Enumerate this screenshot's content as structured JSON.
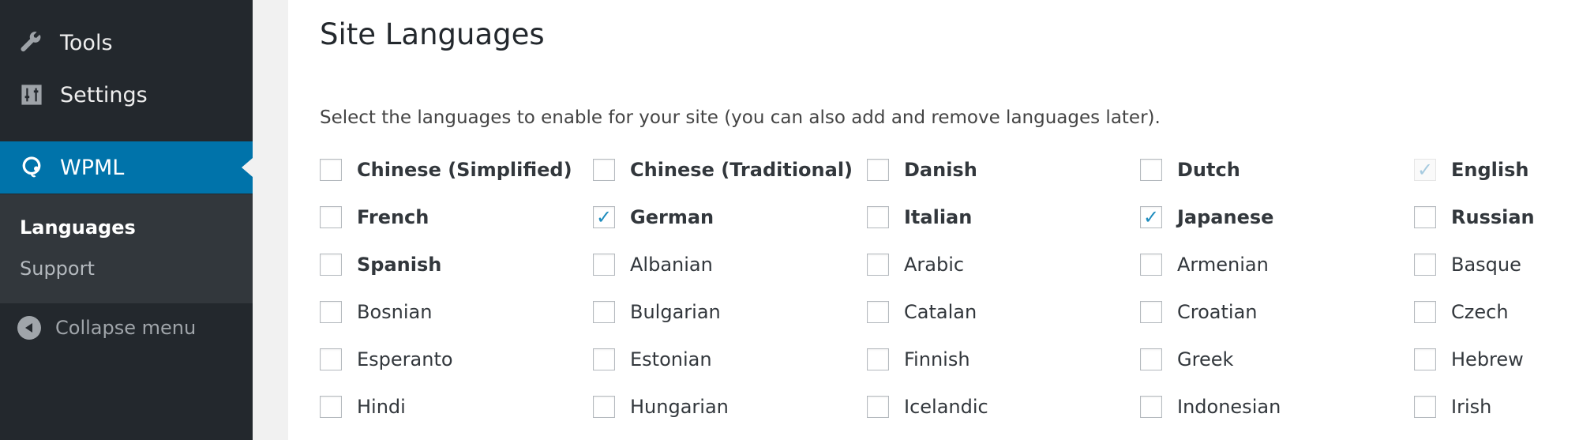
{
  "sidebar": {
    "menu": [
      {
        "label": "Tools",
        "icon": "wrench-icon"
      },
      {
        "label": "Settings",
        "icon": "settings-sliders-icon"
      },
      {
        "label": "WPML",
        "icon": "wpml-icon",
        "current": true
      }
    ],
    "submenu": [
      {
        "label": "Languages",
        "active": true
      },
      {
        "label": "Support",
        "active": false
      }
    ],
    "collapse_label": "Collapse menu"
  },
  "main": {
    "title": "Site Languages",
    "description": "Select the languages to enable for your site (you can also add and remove languages later).",
    "languages": [
      {
        "name": "Chinese (Simplified)",
        "checked": false,
        "bold": true
      },
      {
        "name": "Chinese (Traditional)",
        "checked": false,
        "bold": true
      },
      {
        "name": "Danish",
        "checked": false,
        "bold": true
      },
      {
        "name": "Dutch",
        "checked": false,
        "bold": true
      },
      {
        "name": "English",
        "checked": true,
        "bold": true,
        "disabled": true
      },
      {
        "name": "French",
        "checked": false,
        "bold": true
      },
      {
        "name": "German",
        "checked": true,
        "bold": true
      },
      {
        "name": "Italian",
        "checked": false,
        "bold": true
      },
      {
        "name": "Japanese",
        "checked": true,
        "bold": true
      },
      {
        "name": "Russian",
        "checked": false,
        "bold": true
      },
      {
        "name": "Spanish",
        "checked": false,
        "bold": true
      },
      {
        "name": "Albanian",
        "checked": false,
        "bold": false
      },
      {
        "name": "Arabic",
        "checked": false,
        "bold": false
      },
      {
        "name": "Armenian",
        "checked": false,
        "bold": false
      },
      {
        "name": "Basque",
        "checked": false,
        "bold": false
      },
      {
        "name": "Bosnian",
        "checked": false,
        "bold": false
      },
      {
        "name": "Bulgarian",
        "checked": false,
        "bold": false
      },
      {
        "name": "Catalan",
        "checked": false,
        "bold": false
      },
      {
        "name": "Croatian",
        "checked": false,
        "bold": false
      },
      {
        "name": "Czech",
        "checked": false,
        "bold": false
      },
      {
        "name": "Esperanto",
        "checked": false,
        "bold": false
      },
      {
        "name": "Estonian",
        "checked": false,
        "bold": false
      },
      {
        "name": "Finnish",
        "checked": false,
        "bold": false
      },
      {
        "name": "Greek",
        "checked": false,
        "bold": false
      },
      {
        "name": "Hebrew",
        "checked": false,
        "bold": false
      },
      {
        "name": "Hindi",
        "checked": false,
        "bold": false
      },
      {
        "name": "Hungarian",
        "checked": false,
        "bold": false
      },
      {
        "name": "Icelandic",
        "checked": false,
        "bold": false
      },
      {
        "name": "Indonesian",
        "checked": false,
        "bold": false
      },
      {
        "name": "Irish",
        "checked": false,
        "bold": false
      }
    ]
  },
  "colors": {
    "sidebar_bg": "#23282d",
    "submenu_bg": "#32373c",
    "accent": "#0073aa",
    "checkmark": "#1e8cbe"
  }
}
